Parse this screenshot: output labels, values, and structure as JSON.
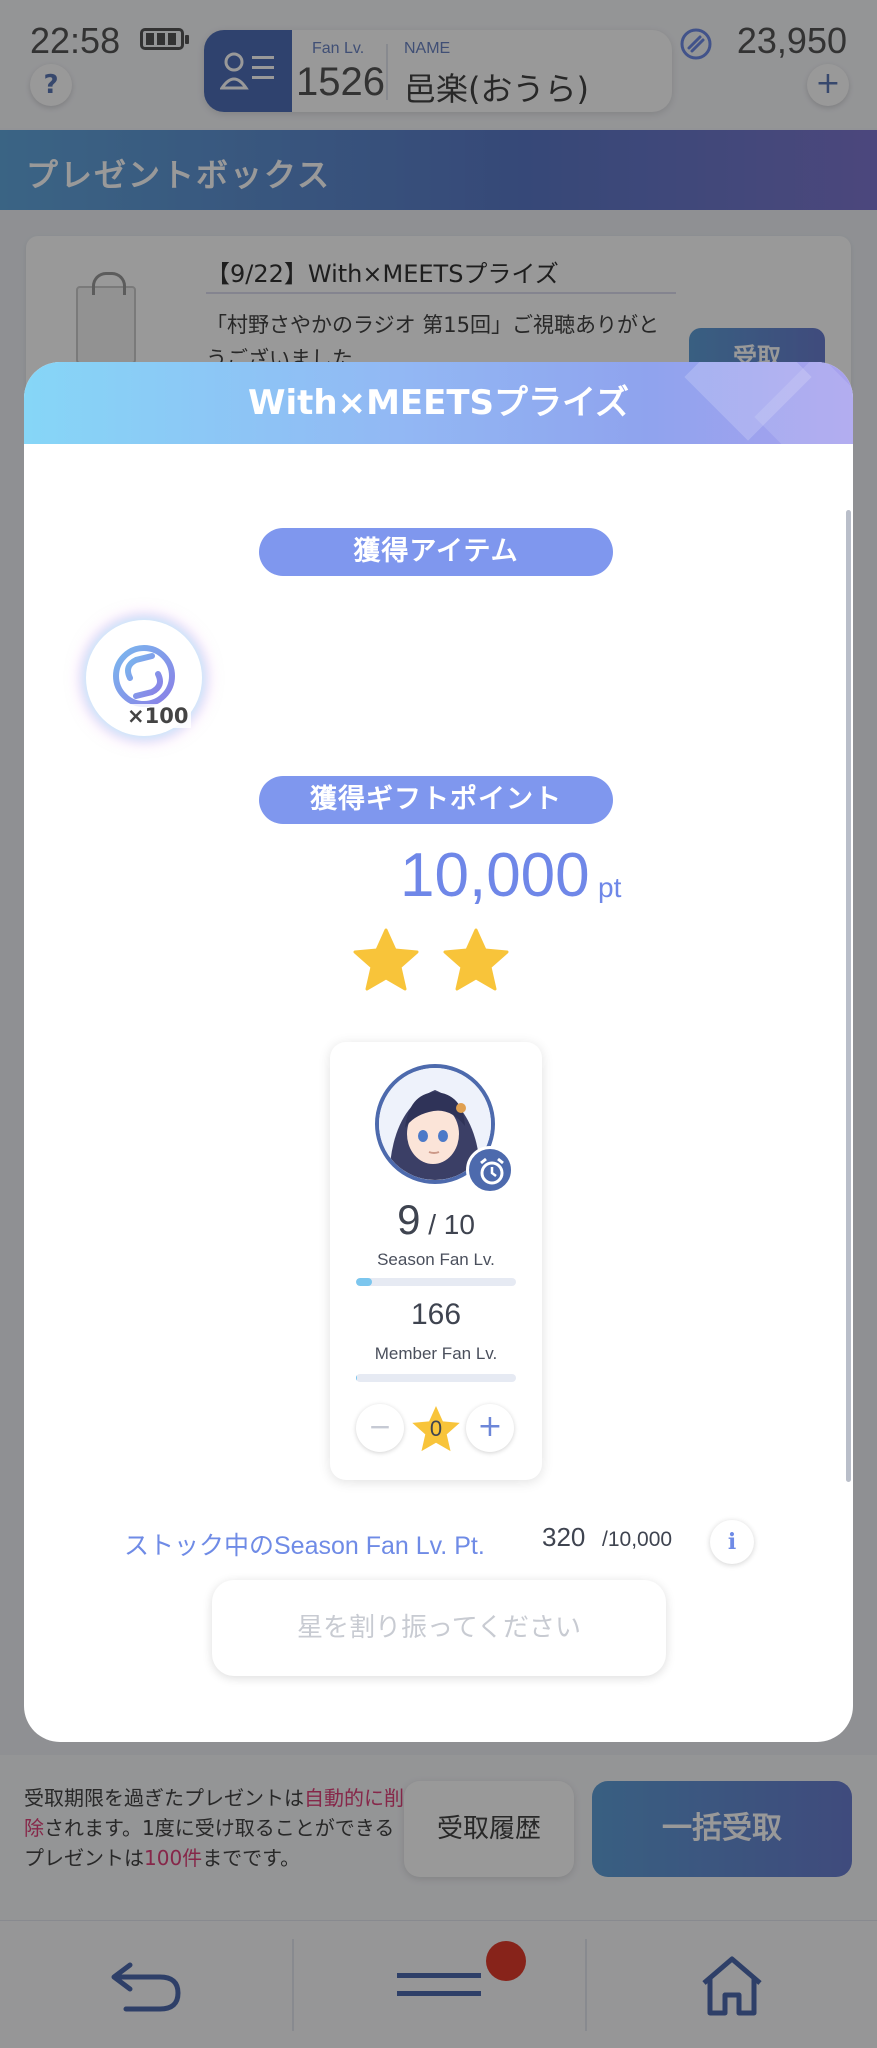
{
  "status_bar": {
    "time": "22:58"
  },
  "profile": {
    "fan_label": "Fan Lv.",
    "fan_level": "1526",
    "name_label": "NAME",
    "name": "邑楽(おうら)"
  },
  "currency": {
    "amount": "23,950"
  },
  "header": {
    "title": "プレゼントボックス"
  },
  "present_item": {
    "title": "【9/22】With×MEETSプライズ",
    "description": "「村野さやかのラジオ 第15回」ご視聴ありがとうございました",
    "receive_label": "受取"
  },
  "footer": {
    "note_part1": "受取期限を過ぎたプレゼントは",
    "note_highlight1": "自動的に削除",
    "note_part2": "されます。1度に受け取ることができるプレゼントは",
    "note_highlight2": "100件",
    "note_part3": "までです。",
    "history_label": "受取履歴",
    "bulk_label": "一括受取"
  },
  "bottom_nav": {
    "notification": true
  },
  "modal": {
    "title": "With×MEETSプライズ",
    "acquired_items_label": "獲得アイテム",
    "item": {
      "icon": "coin-icon",
      "quantity": "×100"
    },
    "gift_points_label": "獲得ギフトポイント",
    "points": "10,000",
    "points_unit": "pt",
    "star_rating": 2,
    "member_card": {
      "season_lv": "9",
      "season_sep": " / ",
      "season_max": "10",
      "season_label": "Season Fan Lv.",
      "season_progress": 0.1,
      "member_lv": "166",
      "member_label": "Member Fan Lv.",
      "member_progress": 0.0,
      "stars_assigned": "0"
    },
    "stock_label": "ストック中のSeason Fan Lv. Pt.",
    "stock_value": "320",
    "stock_max": "/10,000",
    "assign_button": "星を割り振ってください"
  },
  "colors": {
    "accent": "#7f97ee",
    "header_gradient_start": "#86d6f7",
    "star": "#f8c43a",
    "highlight": "#e0427b"
  }
}
